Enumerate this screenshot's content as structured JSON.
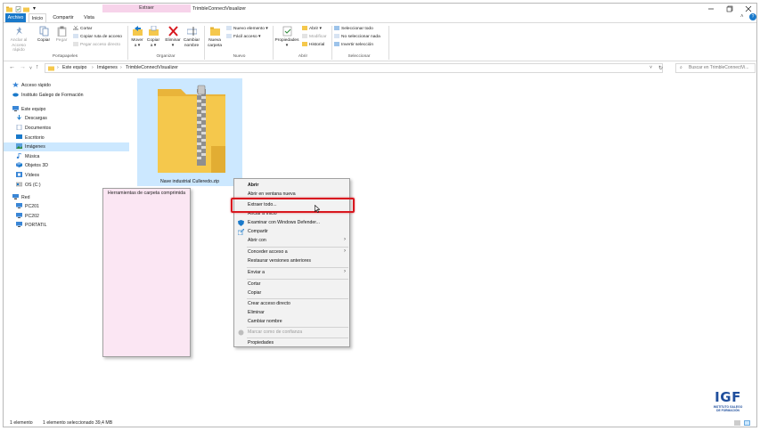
{
  "window": {
    "title": "TrimbleConnectVisualizer",
    "context_tab_header": "Extraer",
    "quick_access_arrow": "▾"
  },
  "tabs": [
    "Archivo",
    "Inicio",
    "Compartir",
    "Vista",
    "Herramientas de carpeta comprimida"
  ],
  "ribbon": {
    "clipboard": {
      "pin": "Anclar al\nAcceso rápido",
      "copy": "Copiar",
      "paste": "Pegar",
      "cut": "Cortar",
      "copy_path": "Copiar ruta de acceso",
      "paste_shortcut": "Pegar acceso directo",
      "group": "Portapapeles"
    },
    "organize": {
      "move": "Mover\na ▾",
      "copy_to": "Copiar\na ▾",
      "delete": "Eliminar\n▾",
      "rename": "Cambiar\nnombre",
      "group": "Organizar"
    },
    "new": {
      "new_folder": "Nueva\ncarpeta",
      "new_item": "Nuevo elemento ▾",
      "easy_access": "Fácil acceso ▾",
      "group": "Nuevo"
    },
    "open": {
      "properties": "Propiedades\n▾",
      "open": "Abrir ▾",
      "edit": "Modificar",
      "history": "Historial",
      "group": "Abrir"
    },
    "select": {
      "select_all": "Seleccionar todo",
      "select_none": "No seleccionar nada",
      "invert": "Invertir selección",
      "group": "Seleccionar"
    }
  },
  "address": {
    "crumbs": [
      "Este equipo",
      "Imágenes",
      "TrimbleConnectVisualizer"
    ],
    "separator": "›",
    "search_placeholder": "Buscar en TrimbleConnectVi..."
  },
  "nav_pane": {
    "quick_access": "Acceso rápido",
    "onedrive": "Instituto Galego de Formación",
    "this_pc": "Este equipo",
    "items": [
      "Descargas",
      "Documentos",
      "Escritorio",
      "Imágenes",
      "Música",
      "Objetos 3D",
      "Vídeos",
      "OS (C:)"
    ],
    "network": "Red",
    "network_items": [
      "PC201",
      "PC202",
      "PORTATIL"
    ]
  },
  "file": {
    "name": "Nave industrial Culleredo.zip"
  },
  "context_menu": {
    "open": "Abrir",
    "open_new_window": "Abrir en ventana nueva",
    "extract_all": "Extraer todo...",
    "pin_start": "Anclar a Inicio",
    "defender": "Examinar con Windows Defender...",
    "share": "Compartir",
    "open_with": "Abrir con",
    "grant_access": "Conceder acceso a",
    "restore": "Restaurar versiones anteriores",
    "send_to": "Enviar a",
    "cut": "Cortar",
    "copy": "Copiar",
    "create_shortcut": "Crear acceso directo",
    "delete": "Eliminar",
    "rename": "Cambiar nombre",
    "trust": "Marcar como de confianza",
    "properties": "Propiedades",
    "submenu_arrow": "›"
  },
  "status": {
    "count": "1 elemento",
    "selected": "1 elemento seleccionado  39,4 MB"
  },
  "logo": {
    "big": "IGF",
    "line1": "INSTITUTO GALEGO",
    "line2": "DE FORMACIÓN"
  },
  "colors": {
    "accent": "#1979ca",
    "selection": "#cce8ff",
    "context_tab": "#f7d3ea",
    "highlight_box": "#d8181f",
    "folder": "#f5c84c"
  }
}
